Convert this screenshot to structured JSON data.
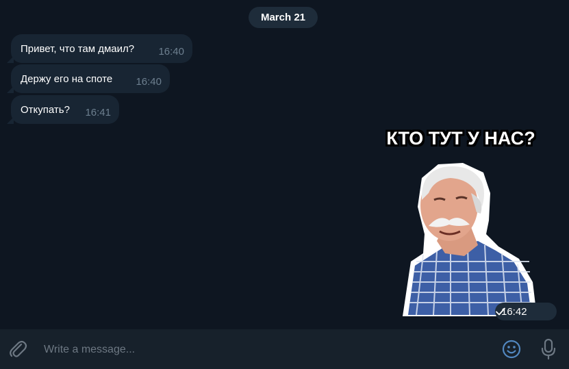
{
  "date_separator": "March 21",
  "messages": [
    {
      "text": "Привет, что там дмаил?",
      "time": "16:40"
    },
    {
      "text": "Держу его на споте",
      "time": "16:40"
    },
    {
      "text": "Откупать?",
      "time": "16:41"
    }
  ],
  "sticker": {
    "caption": "КТО ТУТ У НАС?",
    "time": "16:42",
    "status_icon": "check-icon"
  },
  "composer": {
    "placeholder": "Write a message...",
    "attach_icon": "paperclip-icon",
    "emoji_icon": "smile-icon",
    "mic_icon": "microphone-icon"
  },
  "colors": {
    "background": "#0e1621",
    "incoming_bubble": "#182533",
    "composer": "#17212b",
    "accent": "#5288c1",
    "timestamp": "#6d7f8f"
  }
}
